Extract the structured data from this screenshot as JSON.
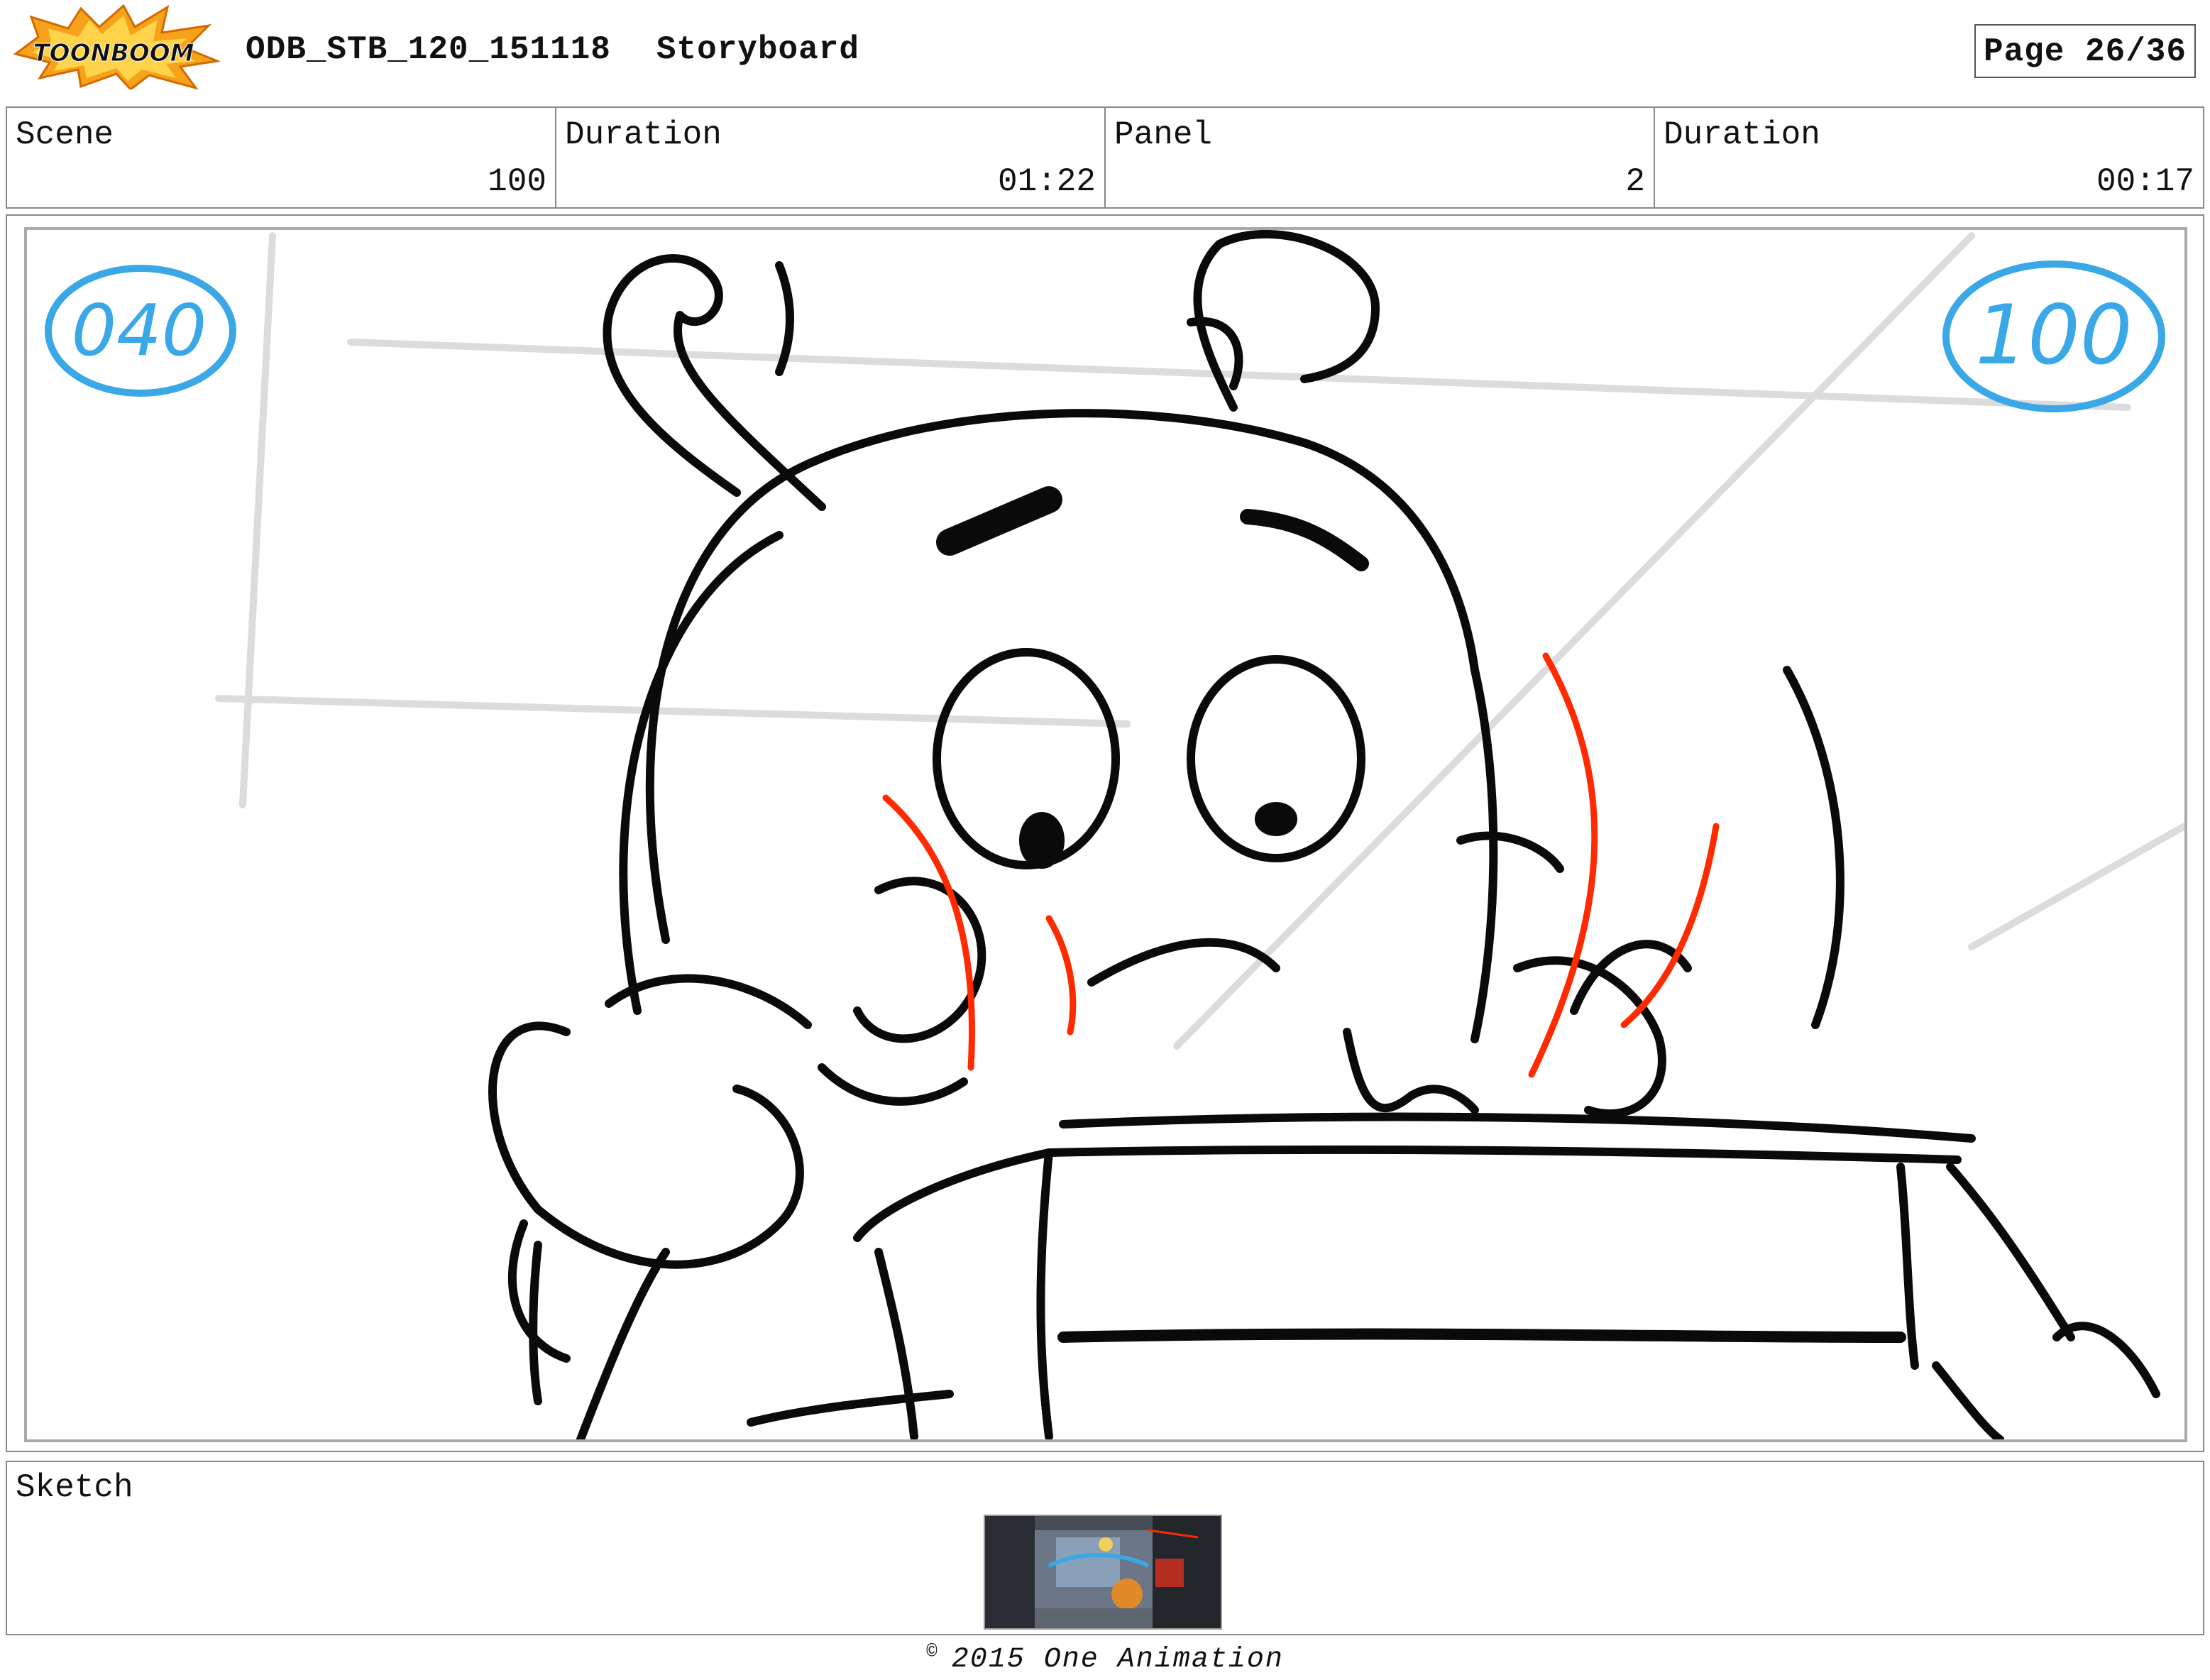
{
  "header": {
    "logo_text": "TOONBOOM",
    "project_code": "ODB_STB_120_151118",
    "doc_type": "Storyboard",
    "page_label": "Page 26/36"
  },
  "info": {
    "scene_label": "Scene",
    "scene_value": "100",
    "scene_duration_label": "Duration",
    "scene_duration_value": "01:22",
    "panel_label": "Panel",
    "panel_value": "2",
    "panel_duration_label": "Duration",
    "panel_duration_value": "00:17"
  },
  "panel": {
    "left_marker": "040",
    "right_marker": "100",
    "marker_color": "#3aa8e6",
    "accent_line_color": "#ff2a00"
  },
  "sketch": {
    "label": "Sketch"
  },
  "footer": {
    "copyright_symbol": "©",
    "copyright_text": "2015 One Animation"
  }
}
